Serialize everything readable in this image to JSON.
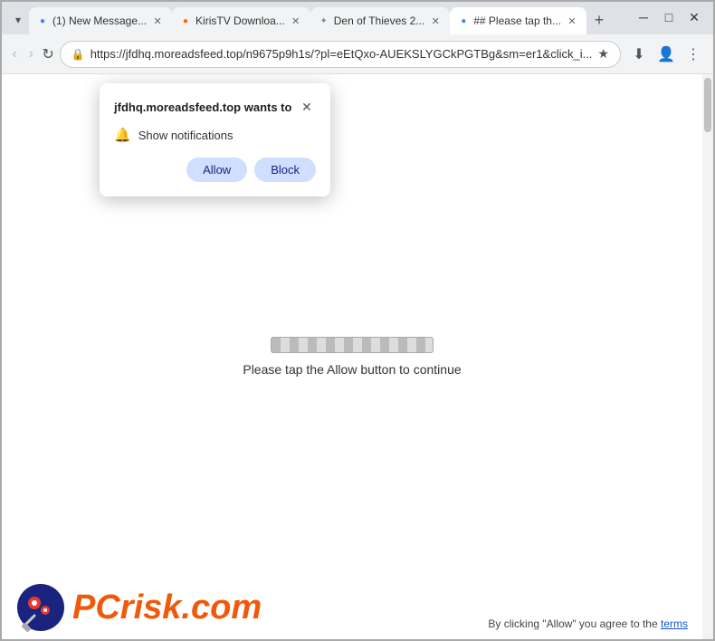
{
  "browser": {
    "tabs": [
      {
        "id": "tab1",
        "title": "(1) New Message...",
        "favicon": "●",
        "active": false
      },
      {
        "id": "tab2",
        "title": "KirisTV Downloa...",
        "favicon": "●",
        "active": false
      },
      {
        "id": "tab3",
        "title": "Den of Thieves 2...",
        "favicon": "✦",
        "active": false
      },
      {
        "id": "tab4",
        "title": "## Please tap th...",
        "favicon": "●",
        "active": true
      }
    ],
    "new_tab_label": "+",
    "window_controls": {
      "minimize": "─",
      "maximize": "□",
      "close": "✕"
    },
    "nav": {
      "back": "‹",
      "forward": "›",
      "refresh": "↻"
    },
    "address_bar": {
      "url": "https://jfdhq.moreadsfeed.top/n9675p9h1s/?pl=eEtQxo-AUEKSLYGCkPGTBg&sm=er1&click_i...",
      "lock_icon": "🔒"
    },
    "toolbar_icons": {
      "bookmark": "★",
      "download": "⬇",
      "profile": "👤",
      "menu": "⋮"
    }
  },
  "popup": {
    "title": "jfdhq.moreadsfeed.top wants to",
    "close_label": "✕",
    "notification_label": "Show notifications",
    "allow_label": "Allow",
    "block_label": "Block"
  },
  "page": {
    "instruction": "Please tap the Allow button to continue"
  },
  "footer": {
    "logo_text_pc": "PC",
    "logo_text_risk": "risk",
    "logo_text_com": ".com",
    "terms_text": "By clicking \"Allow\" you agree to the ",
    "terms_link": "terms"
  }
}
